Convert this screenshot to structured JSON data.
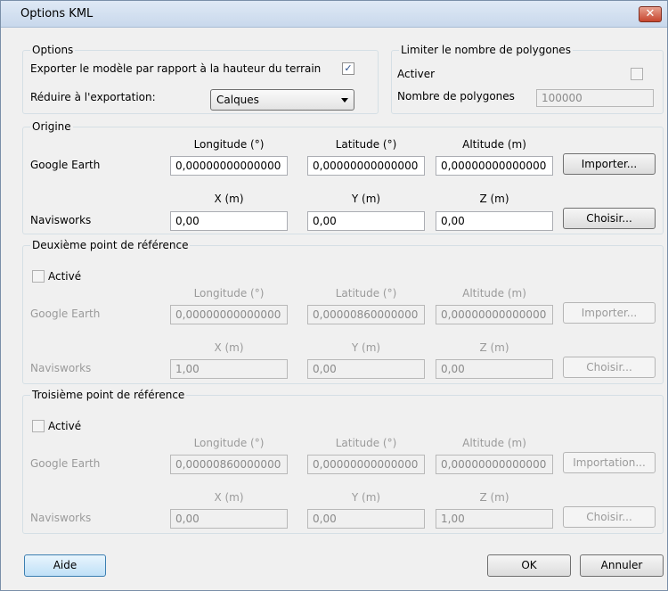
{
  "dialog": {
    "title": "Options KML",
    "close_glyph": "✕"
  },
  "options": {
    "title": "Options",
    "export_label": "Exporter le modèle par rapport à la hauteur du terrain",
    "export_checked": true,
    "reduce_label": "Réduire à l'exportation:",
    "reduce_value": "Calques"
  },
  "limit": {
    "title": "Limiter le nombre de polygones",
    "enable_label": "Activer",
    "enable_checked": false,
    "count_label": "Nombre de polygones",
    "count_value": "100000"
  },
  "origin": {
    "title": "Origine",
    "headers_geo": [
      "Longitude (°)",
      "Latitude (°)",
      "Altitude (m)"
    ],
    "headers_xyz": [
      "X (m)",
      "Y (m)",
      "Z (m)"
    ],
    "row_geo_label": "Google Earth",
    "row_xyz_label": "Navisworks",
    "geo_values": [
      "0,00000000000000",
      "0,00000000000000",
      "0,00000000000000"
    ],
    "xyz_values": [
      "0,00",
      "0,00",
      "0,00"
    ],
    "import_button": "Importer...",
    "choose_button": "Choisir..."
  },
  "second": {
    "title": "Deuxième point de référence",
    "enabled_label": "Activé",
    "enabled_checked": false,
    "geo_values": [
      "0,00000000000000",
      "0,00000860000000",
      "0,00000000000000"
    ],
    "xyz_values": [
      "1,00",
      "0,00",
      "0,00"
    ],
    "import_button": "Importer...",
    "choose_button": "Choisir..."
  },
  "third": {
    "title": "Troisième point de référence",
    "enabled_label": "Activé",
    "enabled_checked": false,
    "geo_values": [
      "0,00000860000000",
      "0,00000000000000",
      "0,00000000000000"
    ],
    "xyz_values": [
      "0,00",
      "0,00",
      "1,00"
    ],
    "import_button": "Importation...",
    "choose_button": "Choisir..."
  },
  "footer": {
    "help_button": "Aide",
    "ok_button": "OK",
    "cancel_button": "Annuler"
  },
  "colors": {
    "accent": "#3c7fb1",
    "disabled_text": "#9a9a9a",
    "close_red": "#c7452e"
  }
}
